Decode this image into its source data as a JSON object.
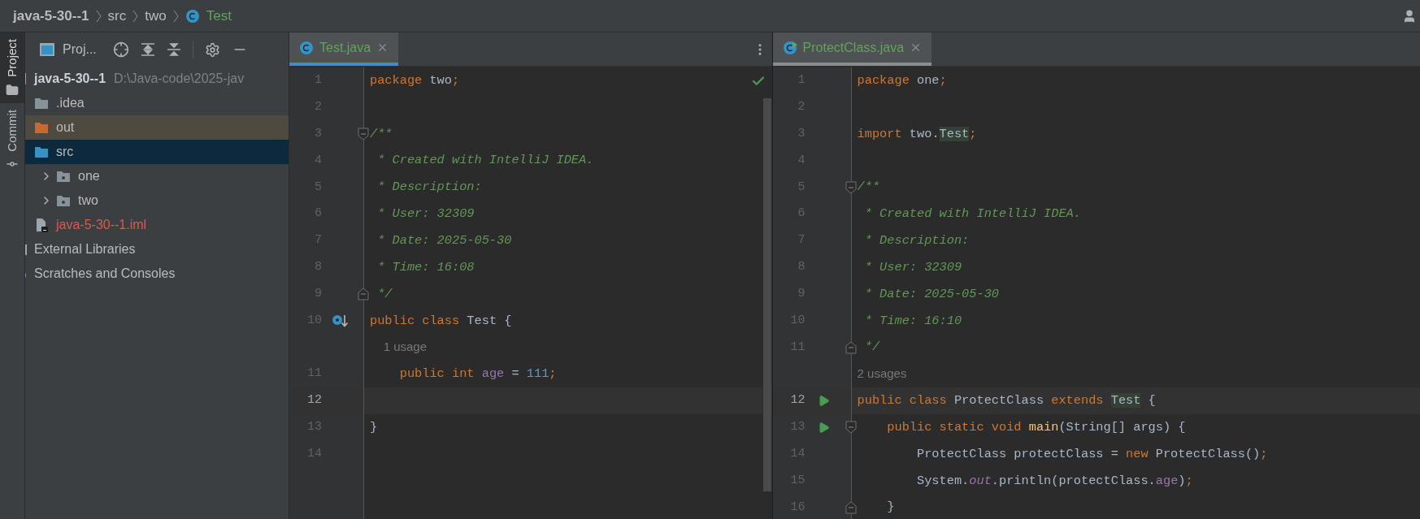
{
  "breadcrumbs": [
    {
      "kind": "project",
      "text": "java-5-30--1"
    },
    {
      "kind": "folder",
      "text": "src"
    },
    {
      "kind": "folder",
      "text": "two"
    },
    {
      "kind": "class",
      "text": "Test"
    }
  ],
  "tool_strip": [
    {
      "kind": "project",
      "label": "Project",
      "selected": true
    },
    {
      "kind": "commit",
      "label": "Commit",
      "selected": false
    }
  ],
  "project_panel": {
    "title": "Proj...",
    "tree": [
      {
        "kind": "module",
        "name": "java-5-30--1",
        "path": "D:\\Java-code\\2025-jav",
        "selected": false,
        "highlighted": false,
        "children": [
          {
            "kind": "folder",
            "name": ".idea",
            "selected": false,
            "highlighted": false
          },
          {
            "kind": "excluded",
            "name": "out",
            "selected": false,
            "highlighted": true
          },
          {
            "kind": "source",
            "name": "src",
            "selected": true,
            "highlighted": false,
            "children": [
              {
                "kind": "package",
                "name": "one",
                "expanded": false,
                "selected": false,
                "highlighted": false
              },
              {
                "kind": "package",
                "name": "two",
                "expanded": false,
                "selected": false,
                "highlighted": false
              }
            ]
          },
          {
            "kind": "module_file",
            "name": "java-5-30--1.iml",
            "selected": false,
            "highlighted": false
          }
        ]
      },
      {
        "kind": "library",
        "name": "External Libraries",
        "selected": false,
        "highlighted": false
      },
      {
        "kind": "scratches",
        "name": "Scratches and Consoles",
        "selected": false,
        "highlighted": false
      }
    ]
  },
  "editors": [
    {
      "focused": true,
      "inspection_ok": true,
      "tab": {
        "kind": "class",
        "label": "Test.java",
        "selected": true
      },
      "lines": [
        {
          "kind": "code",
          "number": "1",
          "current": false,
          "tokens": [
            {
              "kind": "keyword",
              "text": "package "
            },
            {
              "kind": "ident",
              "text": "two"
            },
            {
              "kind": "keyword",
              "text": ";"
            }
          ]
        },
        {
          "kind": "code",
          "number": "2",
          "current": false
        },
        {
          "kind": "code",
          "number": "3",
          "current": false,
          "fold": {
            "kind": "start"
          },
          "tokens": [
            {
              "kind": "comment",
              "text": "/**"
            }
          ]
        },
        {
          "kind": "code",
          "number": "4",
          "current": false,
          "tokens": [
            {
              "kind": "comment",
              "text": " * Created with IntelliJ IDEA."
            }
          ]
        },
        {
          "kind": "code",
          "number": "5",
          "current": false,
          "tokens": [
            {
              "kind": "comment",
              "text": " * Description:"
            }
          ]
        },
        {
          "kind": "code",
          "number": "6",
          "current": false,
          "tokens": [
            {
              "kind": "comment",
              "text": " * User: 32309"
            }
          ]
        },
        {
          "kind": "code",
          "number": "7",
          "current": false,
          "tokens": [
            {
              "kind": "comment",
              "text": " * Date: 2025-05-30"
            }
          ]
        },
        {
          "kind": "code",
          "number": "8",
          "current": false,
          "tokens": [
            {
              "kind": "comment",
              "text": " * Time: 16:08"
            }
          ]
        },
        {
          "kind": "code",
          "number": "9",
          "current": false,
          "fold": {
            "kind": "end"
          },
          "tokens": [
            {
              "kind": "comment",
              "text": " */"
            }
          ]
        },
        {
          "kind": "code",
          "number": "10",
          "current": false,
          "marker": {
            "kind": "implemented"
          },
          "tokens": [
            {
              "kind": "keyword",
              "text": "public class "
            },
            {
              "kind": "ident",
              "text": "Test {"
            }
          ]
        },
        {
          "kind": "hint",
          "text": "    1 usage"
        },
        {
          "kind": "code",
          "number": "11",
          "current": false,
          "tokens": [
            {
              "kind": "keyword",
              "text": "    public int "
            },
            {
              "kind": "field",
              "text": "age"
            },
            {
              "kind": "ident",
              "text": " = "
            },
            {
              "kind": "number",
              "text": "111"
            },
            {
              "kind": "keyword",
              "text": ";"
            }
          ]
        },
        {
          "kind": "code",
          "number": "12",
          "current": true
        },
        {
          "kind": "code",
          "number": "13",
          "current": false,
          "tokens": [
            {
              "kind": "ident",
              "text": "}"
            }
          ]
        },
        {
          "kind": "code",
          "number": "14",
          "current": false
        }
      ]
    },
    {
      "focused": false,
      "inspection_ok": false,
      "tab": {
        "kind": "runnable_class",
        "label": "ProtectClass.java",
        "selected": true
      },
      "lines": [
        {
          "kind": "code",
          "number": "1",
          "current": false,
          "tokens": [
            {
              "kind": "keyword",
              "text": "package "
            },
            {
              "kind": "ident",
              "text": "one"
            },
            {
              "kind": "keyword",
              "text": ";"
            }
          ]
        },
        {
          "kind": "code",
          "number": "2",
          "current": false
        },
        {
          "kind": "code",
          "number": "3",
          "current": false,
          "tokens": [
            {
              "kind": "keyword",
              "text": "import "
            },
            {
              "kind": "ident",
              "text": "two."
            },
            {
              "kind": "usage",
              "text": "Test"
            },
            {
              "kind": "keyword",
              "text": ";"
            }
          ]
        },
        {
          "kind": "code",
          "number": "4",
          "current": false
        },
        {
          "kind": "code",
          "number": "5",
          "current": false,
          "fold": {
            "kind": "start"
          },
          "tokens": [
            {
              "kind": "comment",
              "text": "/**"
            }
          ]
        },
        {
          "kind": "code",
          "number": "6",
          "current": false,
          "tokens": [
            {
              "kind": "comment",
              "text": " * Created with IntelliJ IDEA."
            }
          ]
        },
        {
          "kind": "code",
          "number": "7",
          "current": false,
          "tokens": [
            {
              "kind": "comment",
              "text": " * Description:"
            }
          ]
        },
        {
          "kind": "code",
          "number": "8",
          "current": false,
          "tokens": [
            {
              "kind": "comment",
              "text": " * User: 32309"
            }
          ]
        },
        {
          "kind": "code",
          "number": "9",
          "current": false,
          "tokens": [
            {
              "kind": "comment",
              "text": " * Date: 2025-05-30"
            }
          ]
        },
        {
          "kind": "code",
          "number": "10",
          "current": false,
          "tokens": [
            {
              "kind": "comment",
              "text": " * Time: 16:10"
            }
          ]
        },
        {
          "kind": "code",
          "number": "11",
          "current": false,
          "fold": {
            "kind": "end"
          },
          "tokens": [
            {
              "kind": "comment",
              "text": " */"
            }
          ]
        },
        {
          "kind": "hint",
          "text": "2 usages"
        },
        {
          "kind": "code",
          "number": "12",
          "current": true,
          "marker": {
            "kind": "run"
          },
          "tokens": [
            {
              "kind": "keyword",
              "text": "public class "
            },
            {
              "kind": "ident",
              "text": "ProtectClass "
            },
            {
              "kind": "keyword",
              "text": "extends "
            },
            {
              "kind": "usage",
              "text": "Test"
            },
            {
              "kind": "ident",
              "text": " {"
            }
          ]
        },
        {
          "kind": "code",
          "number": "13",
          "current": false,
          "marker": {
            "kind": "run"
          },
          "fold": {
            "kind": "start"
          },
          "tokens": [
            {
              "kind": "keyword",
              "text": "    public static void "
            },
            {
              "kind": "method",
              "text": "main"
            },
            {
              "kind": "ident",
              "text": "(String[] args) {"
            }
          ]
        },
        {
          "kind": "code",
          "number": "14",
          "current": false,
          "tokens": [
            {
              "kind": "ident",
              "text": "        ProtectClass protectClass = "
            },
            {
              "kind": "keyword",
              "text": "new "
            },
            {
              "kind": "ident",
              "text": "ProtectClass()"
            },
            {
              "kind": "keyword",
              "text": ";"
            }
          ]
        },
        {
          "kind": "code",
          "number": "15",
          "current": false,
          "tokens": [
            {
              "kind": "ident",
              "text": "        System."
            },
            {
              "kind": "static_field",
              "text": "out"
            },
            {
              "kind": "ident",
              "text": ".println(protectClass."
            },
            {
              "kind": "field",
              "text": "age"
            },
            {
              "kind": "ident",
              "text": ")"
            },
            {
              "kind": "keyword",
              "text": ";"
            }
          ]
        },
        {
          "kind": "code",
          "number": "16",
          "current": false,
          "fold": {
            "kind": "end"
          },
          "tokens": [
            {
              "kind": "ident",
              "text": "    }"
            }
          ]
        }
      ]
    }
  ]
}
